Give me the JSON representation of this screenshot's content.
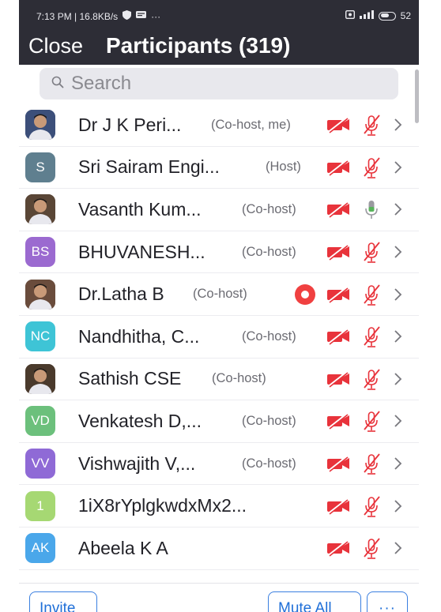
{
  "status_bar": {
    "time_speed": "7:13 PM | 16.8KB/s",
    "dots": "···",
    "battery": "52"
  },
  "header": {
    "close_label": "Close",
    "title": "Participants (319)"
  },
  "search": {
    "placeholder": "Search",
    "value": ""
  },
  "participants": [
    {
      "name": "Dr J K Peri...",
      "role": "(Co-host, me)",
      "avatar": "photo",
      "initials": "",
      "avatar_color": "#3c4f7a",
      "mic": "muted",
      "video": "off",
      "recording": false
    },
    {
      "name": "Sri Sairam Engi...",
      "role": "(Host)",
      "avatar": "initials",
      "initials": "S",
      "avatar_color": "#5f7f8f",
      "mic": "muted",
      "video": "off",
      "recording": false
    },
    {
      "name": "Vasanth Kum...",
      "role": "(Co-host)",
      "avatar": "photo",
      "initials": "",
      "avatar_color": "#5a4636",
      "mic": "on",
      "video": "off",
      "recording": false
    },
    {
      "name": "BHUVANESH...",
      "role": "(Co-host)",
      "avatar": "initials",
      "initials": "BS",
      "avatar_color": "#9b6ad0",
      "mic": "muted",
      "video": "off",
      "recording": false
    },
    {
      "name": "Dr.Latha B",
      "role": "(Co-host)",
      "avatar": "photo",
      "initials": "",
      "avatar_color": "#6a4c3c",
      "mic": "muted",
      "video": "off",
      "recording": true
    },
    {
      "name": "Nandhitha, C...",
      "role": "(Co-host)",
      "avatar": "initials",
      "initials": "NC",
      "avatar_color": "#3ec4d6",
      "mic": "muted",
      "video": "off",
      "recording": false
    },
    {
      "name": "Sathish CSE",
      "role": "(Co-host)",
      "avatar": "photo",
      "initials": "",
      "avatar_color": "#4a3a2c",
      "mic": "muted",
      "video": "off",
      "recording": false
    },
    {
      "name": "Venkatesh D,...",
      "role": "(Co-host)",
      "avatar": "initials",
      "initials": "VD",
      "avatar_color": "#6cc07c",
      "mic": "muted",
      "video": "off",
      "recording": false
    },
    {
      "name": "Vishwajith V,...",
      "role": "(Co-host)",
      "avatar": "initials",
      "initials": "VV",
      "avatar_color": "#8f6ad6",
      "mic": "muted",
      "video": "off",
      "recording": false
    },
    {
      "name": "1iX8rYplgkwdxMx2...",
      "role": "",
      "avatar": "initials",
      "initials": "1",
      "avatar_color": "#a6d873",
      "mic": "muted",
      "video": "off",
      "recording": false
    },
    {
      "name": "Abeela K A",
      "role": "",
      "avatar": "initials",
      "initials": "AK",
      "avatar_color": "#4aa7ea",
      "mic": "muted",
      "video": "off",
      "recording": false
    }
  ],
  "footer": {
    "invite_label": "Invite",
    "mute_all_label": "Mute All",
    "more_label": "···"
  },
  "colors": {
    "header_bg": "#2d2d36",
    "muted_red": "#e8333b",
    "mic_on_green": "#57b35a",
    "link_blue": "#1f6fd8"
  }
}
